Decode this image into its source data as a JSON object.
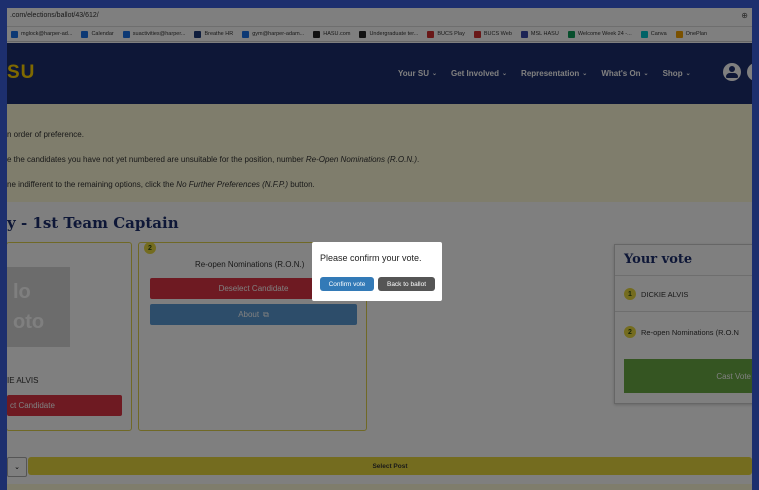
{
  "browser": {
    "url": ".com/elections/ballot/43/612/",
    "bookmarks": [
      {
        "label": "mglock@harper-ad...",
        "color": "#1a73e8"
      },
      {
        "label": "Calendar",
        "color": "#1a73e8"
      },
      {
        "label": "suactivities@harper...",
        "color": "#1a73e8"
      },
      {
        "label": "Breathe HR",
        "color": "#1d3a7a"
      },
      {
        "label": "gym@harper-adam...",
        "color": "#1a73e8"
      },
      {
        "label": "HASU.com",
        "color": "#222222"
      },
      {
        "label": "Undergraduate ter...",
        "color": "#222222"
      },
      {
        "label": "BUCS Play",
        "color": "#d32f2f"
      },
      {
        "label": "BUCS Web",
        "color": "#d32f2f"
      },
      {
        "label": "MSL HASU",
        "color": "#3949ab"
      },
      {
        "label": "Welcome Week 24 -...",
        "color": "#0f9d58"
      },
      {
        "label": "Canva",
        "color": "#00c4cc"
      },
      {
        "label": "OnePlan",
        "color": "#f4a200"
      }
    ]
  },
  "site": {
    "logo": "SU",
    "nav": [
      "Your SU",
      "Get Involved",
      "Representation",
      "What's On",
      "Shop"
    ]
  },
  "instructions": [
    {
      "pre": "n order of preference.",
      "em": "",
      "post": ""
    },
    {
      "pre": "e the candidates you have not yet numbered are unsuitable for the position, number ",
      "em": "Re-Open Nominations (R.O.N.)",
      "post": "."
    },
    {
      "pre": "ne indifferent to the remaining options, click the ",
      "em": "No Further Preferences (N.F.P.)",
      "post": " button."
    }
  ],
  "position_title": "y - 1st Team Captain",
  "candidates": [
    {
      "name": "IE ALVIS",
      "photo_text": [
        "lo",
        "oto"
      ],
      "button": "ct Candidate"
    },
    {
      "rank": "2",
      "name": "Re-open Nominations (R.O.N.)",
      "deselect": "Deselect Candidate",
      "about": "About"
    }
  ],
  "your_vote": {
    "title": "Your vote",
    "items": [
      {
        "rank": "1",
        "name": "DICKIE ALVIS"
      },
      {
        "rank": "2",
        "name": "Re-open Nominations (R.O.N"
      }
    ],
    "cast_button": "Cast Vote"
  },
  "bottom": {
    "select_label": "Select Post",
    "select_mini": "⌄"
  },
  "modal": {
    "message": "Please confirm your vote.",
    "confirm": "Confirm vote",
    "back": "Back to ballot"
  },
  "colors": {
    "brand_navy": "#1d2f6e",
    "brand_yellow": "#ffd200",
    "confirm_blue": "#337ab7",
    "back_grey": "#555555",
    "danger_red": "#dc3545",
    "success_green": "#6aaa45"
  }
}
